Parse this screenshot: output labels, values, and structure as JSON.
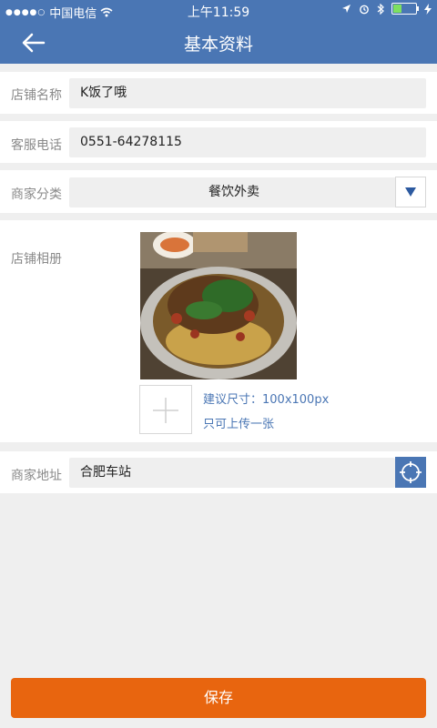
{
  "status_bar": {
    "signal": "●●●●○",
    "carrier": "中国电信",
    "time": "上午11:59",
    "battery_level": 0.35
  },
  "header": {
    "title": "基本资料",
    "back_icon": "arrow-left-icon"
  },
  "form": {
    "shop_name": {
      "label": "店铺名称",
      "value": "K饭了哦"
    },
    "service_phone": {
      "label": "客服电话",
      "value": "0551-64278115"
    },
    "category": {
      "label": "商家分类",
      "value": "餐饮外卖"
    },
    "album": {
      "label": "店铺相册",
      "hint_size": "建议尺寸：100x100px",
      "hint_limit": "只可上传一张"
    },
    "address": {
      "label": "商家地址",
      "value": "合肥车站"
    }
  },
  "save_label": "保存",
  "colors": {
    "primary_blue": "#4a76b4",
    "save_orange": "#e8650f",
    "page_bg": "#efefef"
  }
}
